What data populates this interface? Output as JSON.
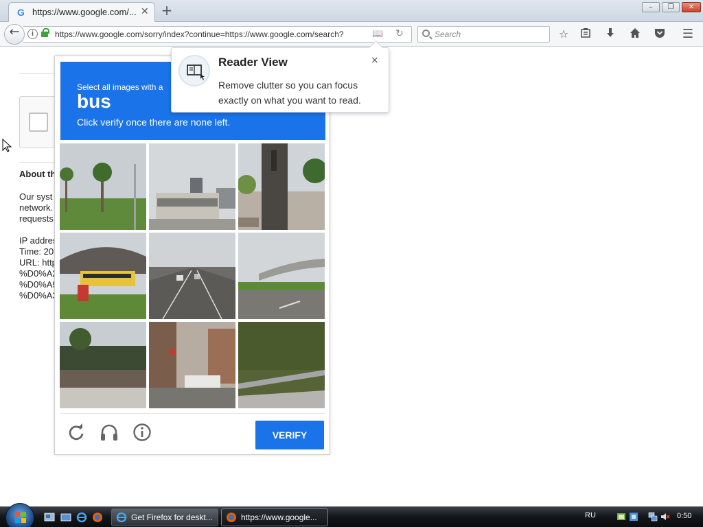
{
  "browser": {
    "tab_title": "https://www.google.com/...",
    "tab_favicon": "G",
    "url": "https://www.google.com/sorry/index?continue=https://www.google.com/search?",
    "search_placeholder": "Search"
  },
  "page": {
    "about_heading": "About th",
    "body_lines": [
      "Our syst",
      "network.",
      "requests",
      "",
      "IP addres",
      "Time: 20:",
      "URL: http",
      "%D0%A2",
      "%D0%A9",
      "%D0%A3"
    ]
  },
  "captcha": {
    "line1": "Select all images with a",
    "target": "bus",
    "line2": "Click verify once there are none left.",
    "verify_label": "VERIFY",
    "accent_color": "#1a73e8"
  },
  "reader_popup": {
    "title": "Reader View",
    "body_line1": "Remove clutter so you can focus",
    "body_line2": "exactly on what you want to read.",
    "close_glyph": "×"
  },
  "taskbar": {
    "items": [
      {
        "label": "Get Firefox for deskt..."
      },
      {
        "label": "https://www.google..."
      }
    ],
    "language": "RU",
    "clock": "0:50"
  }
}
